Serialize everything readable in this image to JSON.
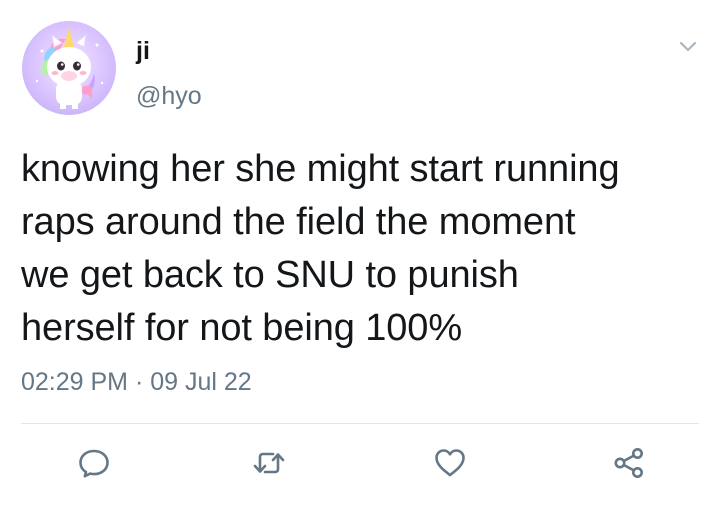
{
  "author": {
    "name": "ji",
    "handle": "@hyo",
    "avatar": "unicorn-avatar"
  },
  "tweet": {
    "lines": [
      "knowing her she might start running",
      "raps around the field the moment",
      "we get back to SNU to punish",
      "herself for not being 100%"
    ],
    "time": "02:29 PM",
    "separator": "·",
    "date": "09 Jul 22"
  },
  "actions": [
    {
      "icon": "reply-icon"
    },
    {
      "icon": "retweet-icon"
    },
    {
      "icon": "like-icon"
    },
    {
      "icon": "share-icon"
    }
  ],
  "colors": {
    "text": "#14171a",
    "secondary": "#657786",
    "divider": "#e1e8ed"
  }
}
